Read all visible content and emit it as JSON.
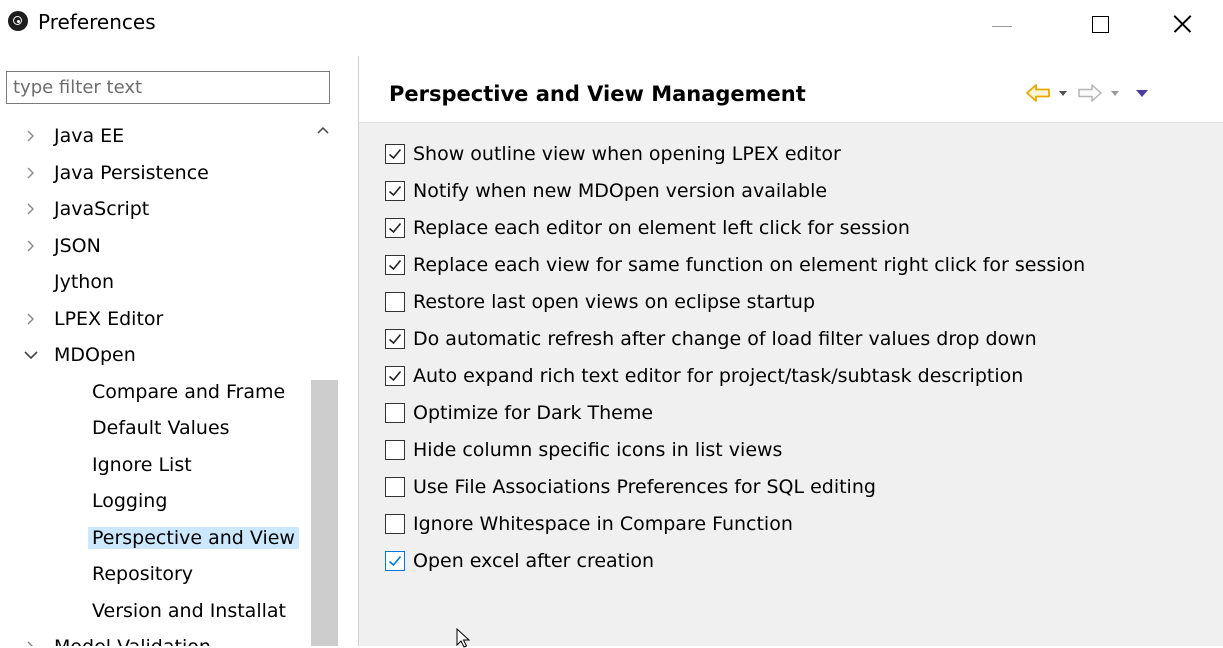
{
  "window": {
    "title": "Preferences"
  },
  "filter": {
    "placeholder": "type filter text",
    "value": ""
  },
  "tree": {
    "items": [
      {
        "label": "Java EE",
        "expandable": true,
        "expanded": false,
        "level": 0
      },
      {
        "label": "Java Persistence",
        "expandable": true,
        "expanded": false,
        "level": 0
      },
      {
        "label": "JavaScript",
        "expandable": true,
        "expanded": false,
        "level": 0
      },
      {
        "label": "JSON",
        "expandable": true,
        "expanded": false,
        "level": 0
      },
      {
        "label": "Jython",
        "expandable": false,
        "expanded": false,
        "level": 0
      },
      {
        "label": "LPEX Editor",
        "expandable": true,
        "expanded": false,
        "level": 0
      },
      {
        "label": "MDOpen",
        "expandable": true,
        "expanded": true,
        "level": 0
      },
      {
        "label": "Compare and Frame",
        "expandable": false,
        "level": 1
      },
      {
        "label": "Default Values",
        "expandable": false,
        "level": 1
      },
      {
        "label": "Ignore List",
        "expandable": false,
        "level": 1
      },
      {
        "label": "Logging",
        "expandable": false,
        "level": 1
      },
      {
        "label": "Perspective and View",
        "expandable": false,
        "level": 1,
        "selected": true
      },
      {
        "label": "Repository",
        "expandable": false,
        "level": 1
      },
      {
        "label": "Version and Installat",
        "expandable": false,
        "level": 1
      },
      {
        "label": "Model Validation",
        "expandable": true,
        "expanded": false,
        "level": 0
      }
    ]
  },
  "page": {
    "title": "Perspective and View Management",
    "nav": {
      "back_icon": "back-arrow-icon",
      "forward_icon": "forward-arrow-icon",
      "menu_icon": "view-menu-icon"
    }
  },
  "options": [
    {
      "label": "Show outline view when opening LPEX editor",
      "checked": true
    },
    {
      "label": "Notify when new MDOpen version available",
      "checked": true
    },
    {
      "label": "Replace each editor on element left click for session",
      "checked": true
    },
    {
      "label": "Replace each view for same function on element right click for session",
      "checked": true
    },
    {
      "label": "Restore last open views on eclipse startup",
      "checked": false
    },
    {
      "label": "Do automatic refresh after change of load filter values drop down",
      "checked": true
    },
    {
      "label": "Auto expand rich text editor for project/task/subtask description",
      "checked": true
    },
    {
      "label": "Optimize for Dark Theme",
      "checked": false
    },
    {
      "label": "Hide column specific icons in list views",
      "checked": false
    },
    {
      "label": "Use File Associations Preferences for SQL editing",
      "checked": false
    },
    {
      "label": "Ignore Whitespace in Compare Function",
      "checked": false
    },
    {
      "label": "Open excel after creation",
      "checked": true,
      "focused": true
    }
  ],
  "colors": {
    "selection": "#cce8ff",
    "accent": "#0078d7",
    "back_arrow": "#f0b400",
    "right_bg": "#f0f0f0",
    "menu_arrow": "#4b3f9e"
  }
}
